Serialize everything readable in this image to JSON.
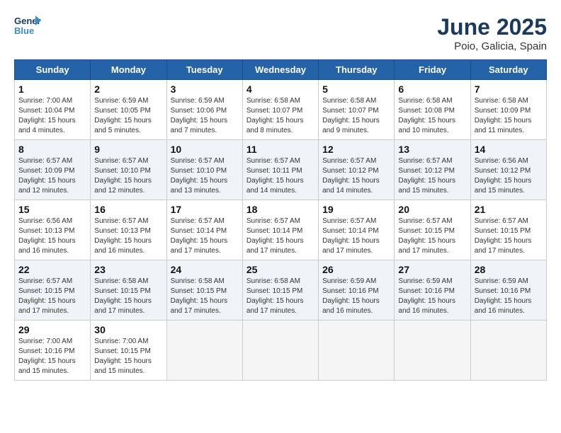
{
  "logo": {
    "line1": "General",
    "line2": "Blue"
  },
  "title": "June 2025",
  "subtitle": "Poio, Galicia, Spain",
  "weekdays": [
    "Sunday",
    "Monday",
    "Tuesday",
    "Wednesday",
    "Thursday",
    "Friday",
    "Saturday"
  ],
  "weeks": [
    [
      {
        "day": 1,
        "sunrise": "7:00 AM",
        "sunset": "10:04 PM",
        "daylight": "15 hours and 4 minutes."
      },
      {
        "day": 2,
        "sunrise": "6:59 AM",
        "sunset": "10:05 PM",
        "daylight": "15 hours and 5 minutes."
      },
      {
        "day": 3,
        "sunrise": "6:59 AM",
        "sunset": "10:06 PM",
        "daylight": "15 hours and 7 minutes."
      },
      {
        "day": 4,
        "sunrise": "6:58 AM",
        "sunset": "10:07 PM",
        "daylight": "15 hours and 8 minutes."
      },
      {
        "day": 5,
        "sunrise": "6:58 AM",
        "sunset": "10:07 PM",
        "daylight": "15 hours and 9 minutes."
      },
      {
        "day": 6,
        "sunrise": "6:58 AM",
        "sunset": "10:08 PM",
        "daylight": "15 hours and 10 minutes."
      },
      {
        "day": 7,
        "sunrise": "6:58 AM",
        "sunset": "10:09 PM",
        "daylight": "15 hours and 11 minutes."
      }
    ],
    [
      {
        "day": 8,
        "sunrise": "6:57 AM",
        "sunset": "10:09 PM",
        "daylight": "15 hours and 12 minutes."
      },
      {
        "day": 9,
        "sunrise": "6:57 AM",
        "sunset": "10:10 PM",
        "daylight": "15 hours and 12 minutes."
      },
      {
        "day": 10,
        "sunrise": "6:57 AM",
        "sunset": "10:10 PM",
        "daylight": "15 hours and 13 minutes."
      },
      {
        "day": 11,
        "sunrise": "6:57 AM",
        "sunset": "10:11 PM",
        "daylight": "15 hours and 14 minutes."
      },
      {
        "day": 12,
        "sunrise": "6:57 AM",
        "sunset": "10:12 PM",
        "daylight": "15 hours and 14 minutes."
      },
      {
        "day": 13,
        "sunrise": "6:57 AM",
        "sunset": "10:12 PM",
        "daylight": "15 hours and 15 minutes."
      },
      {
        "day": 14,
        "sunrise": "6:56 AM",
        "sunset": "10:12 PM",
        "daylight": "15 hours and 15 minutes."
      }
    ],
    [
      {
        "day": 15,
        "sunrise": "6:56 AM",
        "sunset": "10:13 PM",
        "daylight": "15 hours and 16 minutes."
      },
      {
        "day": 16,
        "sunrise": "6:57 AM",
        "sunset": "10:13 PM",
        "daylight": "15 hours and 16 minutes."
      },
      {
        "day": 17,
        "sunrise": "6:57 AM",
        "sunset": "10:14 PM",
        "daylight": "15 hours and 17 minutes."
      },
      {
        "day": 18,
        "sunrise": "6:57 AM",
        "sunset": "10:14 PM",
        "daylight": "15 hours and 17 minutes."
      },
      {
        "day": 19,
        "sunrise": "6:57 AM",
        "sunset": "10:14 PM",
        "daylight": "15 hours and 17 minutes."
      },
      {
        "day": 20,
        "sunrise": "6:57 AM",
        "sunset": "10:15 PM",
        "daylight": "15 hours and 17 minutes."
      },
      {
        "day": 21,
        "sunrise": "6:57 AM",
        "sunset": "10:15 PM",
        "daylight": "15 hours and 17 minutes."
      }
    ],
    [
      {
        "day": 22,
        "sunrise": "6:57 AM",
        "sunset": "10:15 PM",
        "daylight": "15 hours and 17 minutes."
      },
      {
        "day": 23,
        "sunrise": "6:58 AM",
        "sunset": "10:15 PM",
        "daylight": "15 hours and 17 minutes."
      },
      {
        "day": 24,
        "sunrise": "6:58 AM",
        "sunset": "10:15 PM",
        "daylight": "15 hours and 17 minutes."
      },
      {
        "day": 25,
        "sunrise": "6:58 AM",
        "sunset": "10:15 PM",
        "daylight": "15 hours and 17 minutes."
      },
      {
        "day": 26,
        "sunrise": "6:59 AM",
        "sunset": "10:16 PM",
        "daylight": "15 hours and 16 minutes."
      },
      {
        "day": 27,
        "sunrise": "6:59 AM",
        "sunset": "10:16 PM",
        "daylight": "15 hours and 16 minutes."
      },
      {
        "day": 28,
        "sunrise": "6:59 AM",
        "sunset": "10:16 PM",
        "daylight": "15 hours and 16 minutes."
      }
    ],
    [
      {
        "day": 29,
        "sunrise": "7:00 AM",
        "sunset": "10:16 PM",
        "daylight": "15 hours and 15 minutes."
      },
      {
        "day": 30,
        "sunrise": "7:00 AM",
        "sunset": "10:15 PM",
        "daylight": "15 hours and 15 minutes."
      },
      null,
      null,
      null,
      null,
      null
    ]
  ],
  "labels": {
    "sunrise": "Sunrise:",
    "sunset": "Sunset:",
    "daylight": "Daylight:"
  }
}
